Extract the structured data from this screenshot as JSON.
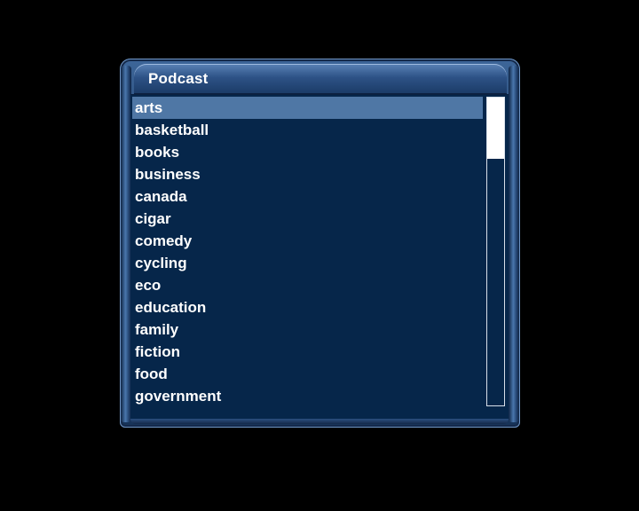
{
  "dialog": {
    "title": "Podcast"
  },
  "list": {
    "selected_index": 0,
    "items": [
      {
        "label": "arts"
      },
      {
        "label": "basketball"
      },
      {
        "label": "books"
      },
      {
        "label": "business"
      },
      {
        "label": "canada"
      },
      {
        "label": "cigar"
      },
      {
        "label": "comedy"
      },
      {
        "label": "cycling"
      },
      {
        "label": "eco"
      },
      {
        "label": "education"
      },
      {
        "label": "family"
      },
      {
        "label": "fiction"
      },
      {
        "label": "food"
      },
      {
        "label": "government"
      }
    ]
  },
  "scrollbar": {
    "thumb_fraction": 0.2,
    "position_fraction": 0.0
  },
  "colors": {
    "background": "#000000",
    "list_background": "#06264a",
    "selection": "#4f77a5",
    "text": "#ffffff",
    "frame": "#3d6699"
  }
}
